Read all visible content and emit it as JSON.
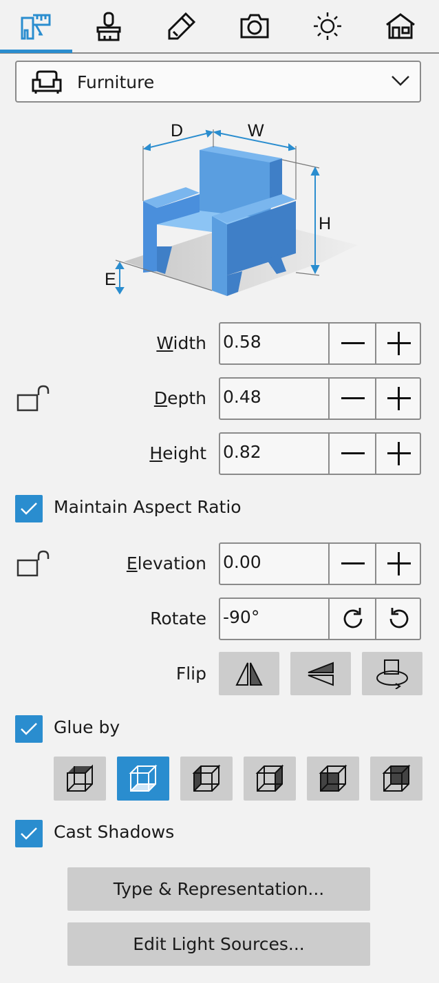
{
  "tabs": [
    {
      "icon": "dimensions-icon",
      "selected": true
    },
    {
      "icon": "brush-icon",
      "selected": false
    },
    {
      "icon": "pencil-icon",
      "selected": false
    },
    {
      "icon": "camera-icon",
      "selected": false
    },
    {
      "icon": "sun-icon",
      "selected": false
    },
    {
      "icon": "house-icon",
      "selected": false
    }
  ],
  "category": {
    "selected": "Furniture",
    "icon": "armchair-icon"
  },
  "diagram": {
    "d": "D",
    "w": "W",
    "h": "H",
    "e": "E"
  },
  "dimensions": {
    "width": {
      "label_first": "W",
      "label_rest": "idth",
      "value": "0.58"
    },
    "depth": {
      "label_first": "D",
      "label_rest": "epth",
      "value": "0.48"
    },
    "height": {
      "label_first": "H",
      "label_rest": "eight",
      "value": "0.82"
    }
  },
  "maintain_aspect": {
    "label": "Maintain Aspect Ratio",
    "checked": true
  },
  "elevation": {
    "label_first": "E",
    "label_rest": "levation",
    "value": "0.00"
  },
  "rotate": {
    "label": "Rotate",
    "value": "-90°"
  },
  "flip": {
    "label": "Flip"
  },
  "glue_by": {
    "label": "Glue by",
    "checked": true,
    "selected_index": 1
  },
  "cast_shadows": {
    "label": "Cast Shadows",
    "checked": true
  },
  "buttons": {
    "type_representation": "Type & Representation...",
    "edit_light_sources": "Edit Light Sources..."
  },
  "colors": {
    "accent": "#2a8dcf",
    "chair": "#4a90d9"
  }
}
